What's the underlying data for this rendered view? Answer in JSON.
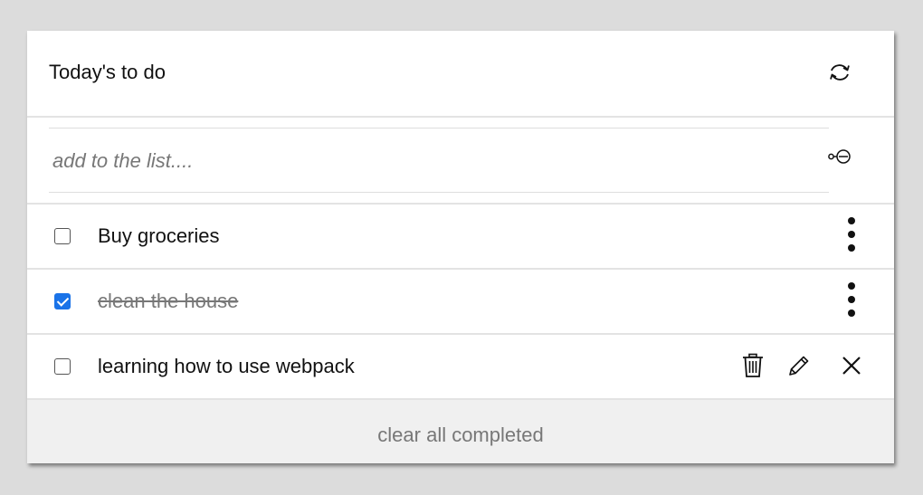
{
  "header": {
    "title": "Today's to do",
    "refresh_icon": "refresh-icon"
  },
  "new_task": {
    "placeholder": "add to the list....",
    "value": "",
    "enter_icon": "enter-icon"
  },
  "tasks": [
    {
      "description": "Buy groceries",
      "completed": false,
      "actions": "more-options"
    },
    {
      "description": "clean the house",
      "completed": true,
      "actions": "more-options"
    },
    {
      "description": "learning how to use webpack",
      "completed": false,
      "actions": [
        "trash-icon",
        "pencil-icon",
        "close-icon"
      ]
    }
  ],
  "footer": {
    "clear_label": "clear all completed"
  },
  "colors": {
    "accent": "#1a73e8",
    "background": "#dcdcdc",
    "card": "#ffffff",
    "footer": "#f0f0f0"
  }
}
